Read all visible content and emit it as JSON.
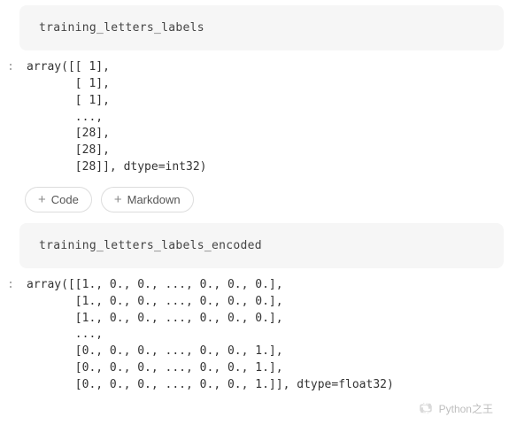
{
  "cells": {
    "input1": "training_letters_labels",
    "output1": "array([[ 1],\n       [ 1],\n       [ 1],\n       ...,\n       [28],\n       [28],\n       [28]], dtype=int32)",
    "input2": "training_letters_labels_encoded",
    "output2": "array([[1., 0., 0., ..., 0., 0., 0.],\n       [1., 0., 0., ..., 0., 0., 0.],\n       [1., 0., 0., ..., 0., 0., 0.],\n       ...,\n       [0., 0., 0., ..., 0., 0., 1.],\n       [0., 0., 0., ..., 0., 0., 1.],\n       [0., 0., 0., ..., 0., 0., 1.]], dtype=float32)"
  },
  "prompts": {
    "out1": ":",
    "out2": ":"
  },
  "buttons": {
    "code": "Code",
    "markdown": "Markdown",
    "plus": "+"
  },
  "watermark": {
    "text": "Python之王"
  }
}
